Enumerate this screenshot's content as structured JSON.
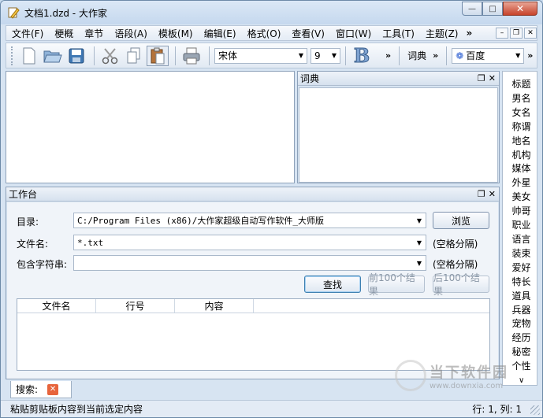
{
  "window": {
    "title": "文档1.dzd - 大作家"
  },
  "window_controls": {
    "minimize": "—",
    "maximize": "□",
    "close": "✕"
  },
  "menu": {
    "items": [
      {
        "label": "文件(F)"
      },
      {
        "label": "梗概"
      },
      {
        "label": "章节"
      },
      {
        "label": "语段(A)"
      },
      {
        "label": "模板(M)"
      },
      {
        "label": "编辑(E)"
      },
      {
        "label": "格式(O)"
      },
      {
        "label": "查看(V)"
      },
      {
        "label": "窗口(W)"
      },
      {
        "label": "工具(T)"
      },
      {
        "label": "主题(Z)"
      }
    ],
    "overflow": "»",
    "mdi": {
      "minimize": "–",
      "restore": "❐",
      "close": "✕"
    }
  },
  "toolbar": {
    "font_name": "宋体",
    "font_size": "9",
    "bold_icon": "B",
    "dict_label": "词典",
    "search_engine": "百度",
    "chevron": "»"
  },
  "dictionary": {
    "title": "词典",
    "float_btn": "❐",
    "close_btn": "✕"
  },
  "sidebar": {
    "items": [
      "标题",
      "男名",
      "女名",
      "称谓",
      "地名",
      "机构",
      "媒体",
      "外星",
      "美女",
      "帅哥",
      "职业",
      "语言",
      "装束",
      "爱好",
      "特长",
      "道具",
      "兵器",
      "宠物",
      "经历",
      "秘密",
      "个性"
    ],
    "scroll": "∨"
  },
  "workbench": {
    "title": "工作台",
    "float_btn": "❐",
    "close_btn": "✕",
    "dir_label": "目录:",
    "dir_value": "C:/Program Files (x86)/大作家超级自动写作软件_大师版",
    "browse_btn": "浏览",
    "filename_label": "文件名:",
    "filename_value": "*.txt",
    "filename_hint": "(空格分隔)",
    "contains_label": "包含字符串:",
    "contains_value": "",
    "contains_hint": "(空格分隔)",
    "find_btn": "查找",
    "prev_btn": "前100个结果",
    "next_btn": "后100个结果",
    "columns": [
      "文件名",
      "行号",
      "内容"
    ]
  },
  "search_tab": {
    "label": "搜索:",
    "close": "✕"
  },
  "status": {
    "message": "粘贴剪贴板内容到当前选定内容",
    "position": "行: 1, 列: 1"
  },
  "watermark": {
    "cn": "当下软件园",
    "url": "www.downxia.com"
  }
}
